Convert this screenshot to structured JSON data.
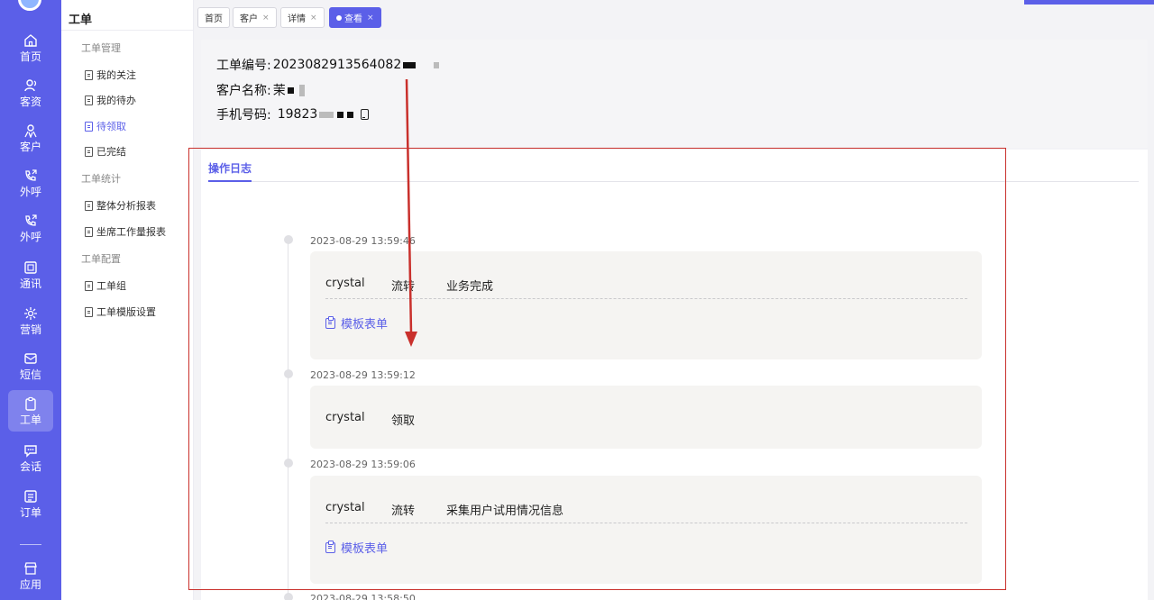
{
  "rail": {
    "items": [
      {
        "label": "首页",
        "icon": "home-icon"
      },
      {
        "label": "客资",
        "icon": "leads-icon"
      },
      {
        "label": "客户",
        "icon": "customer-icon"
      },
      {
        "label": "外呼",
        "icon": "outbound-call-icon"
      },
      {
        "label": "外呼",
        "icon": "outbound-call-icon"
      },
      {
        "label": "通讯",
        "icon": "contacts-icon"
      },
      {
        "label": "营销",
        "icon": "marketing-icon"
      },
      {
        "label": "短信",
        "icon": "sms-icon"
      },
      {
        "label": "工单",
        "icon": "work-order-icon"
      },
      {
        "label": "会话",
        "icon": "chat-icon"
      },
      {
        "label": "订单",
        "icon": "order-icon"
      },
      {
        "label": "应用",
        "icon": "app-store-icon"
      }
    ],
    "active_index": 8
  },
  "submenu": {
    "title": "工单",
    "groups": [
      {
        "label": "工单管理",
        "items": [
          "我的关注",
          "我的待办",
          "待领取",
          "已完结"
        ]
      },
      {
        "label": "工单统计",
        "items": [
          "整体分析报表",
          "坐席工作量报表"
        ]
      },
      {
        "label": "工单配置",
        "items": [
          "工单组",
          "工单模版设置"
        ]
      }
    ],
    "active_item": "待领取"
  },
  "tabs": [
    {
      "label": "首页",
      "closable": false
    },
    {
      "label": "客户",
      "closable": true
    },
    {
      "label": "详情",
      "closable": true
    },
    {
      "label": "查看",
      "closable": true,
      "active": true
    }
  ],
  "close_glyph": "×",
  "ticket": {
    "id_label": "工单编号:",
    "id_value": "2023082913564082",
    "customer_label": "客户名称:",
    "customer_value": "茉",
    "phone_label": "手机号码:",
    "phone_value": "19823"
  },
  "log": {
    "tab_label": "操作日志",
    "entries": [
      {
        "time": "2023-08-29 13:59:46",
        "user": "crystal",
        "action": "流转",
        "detail": "业务完成",
        "link": "模板表单"
      },
      {
        "time": "2023-08-29 13:59:12",
        "user": "crystal",
        "action": "领取",
        "detail": "",
        "link": ""
      },
      {
        "time": "2023-08-29 13:59:06",
        "user": "crystal",
        "action": "流转",
        "detail": "采集用户试用情况信息",
        "link": "模板表单"
      },
      {
        "time": "2023-08-29 13:58:50"
      }
    ]
  },
  "colors": {
    "accent": "#5b5fe8",
    "annotation": "#c9302c"
  }
}
